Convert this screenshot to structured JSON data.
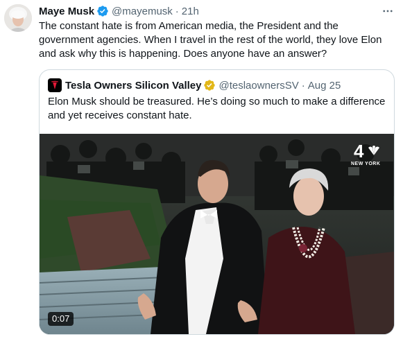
{
  "author": {
    "name": "Maye Musk",
    "handle": "@mayemusk",
    "separator": "·",
    "time": "21h"
  },
  "tweet": {
    "text": "The constant hate is from American media, the President and the government agencies. When I travel in the rest of the world, they love Elon and ask why this is happening. Does anyone have an answer?"
  },
  "quoted": {
    "name": "Tesla Owners Silicon Valley",
    "handle": "@teslaownersSV",
    "separator": "·",
    "date": "Aug 25",
    "text": "Elon Musk should be treasured. He’s doing so much to make a difference and yet receives constant hate.",
    "media": {
      "duration": "0:07",
      "watermark_number": "4",
      "watermark_text": "NEW YORK"
    }
  },
  "colors": {
    "verified_blue": "#1d9bf0",
    "verified_gold": "#e2b719",
    "secondary_text": "#536471",
    "border": "#cfd9de"
  },
  "icons": {
    "more": "more-horizontal-icon",
    "verified": "verified-badge-icon",
    "quote_avatar": "tesla-logo-icon"
  }
}
